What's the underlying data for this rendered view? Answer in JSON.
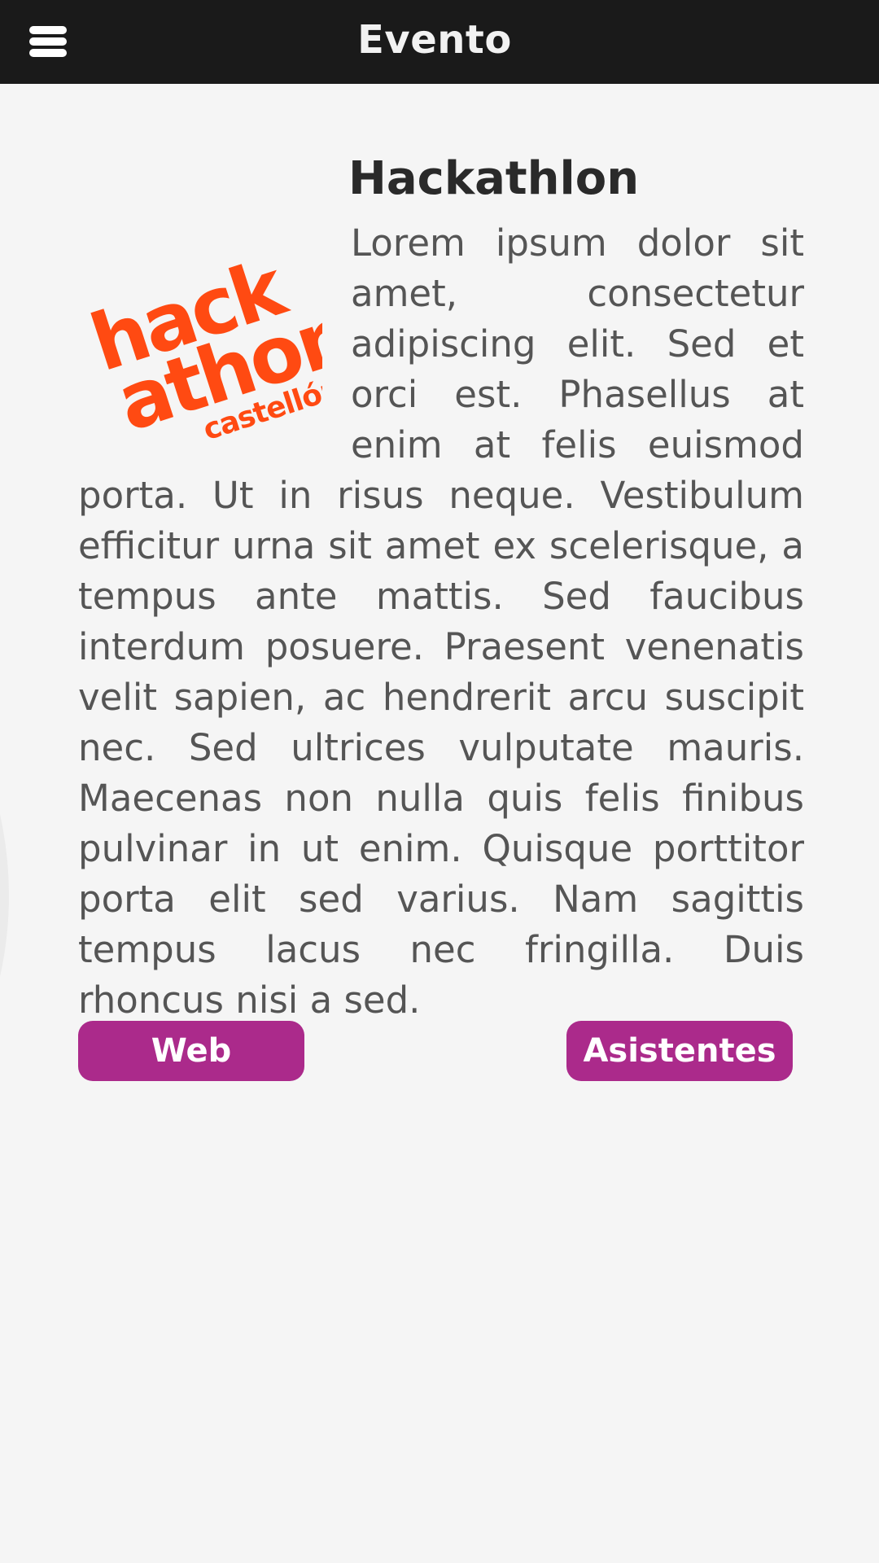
{
  "header": {
    "title": "Evento",
    "menu_icon": "hamburger-menu-icon",
    "background": "#1a1a1a"
  },
  "event": {
    "title": "Hackathlon",
    "logo": {
      "name": "hackathon-castellon-logo",
      "line1": "hack",
      "line2": "athon",
      "line3": "castellón",
      "color": "#ff4a12"
    },
    "description": "Lorem ipsum dolor sit amet, consectetur adipiscing elit. Sed et orci est. Phasellus at enim at felis euismod porta. Ut in risus neque. Vestibulum efficitur urna sit amet ex scelerisque, a tempus ante mattis. Sed faucibus interdum posuere. Praesent venenatis velit sapien, ac hendrerit arcu suscipit nec. Sed ultrices vulputate mauris. Maecenas non nulla quis felis finibus pulvinar in ut enim. Quisque porttitor porta elit sed varius. Nam sagittis tempus lacus nec fringilla. Duis rhoncus nisi a sed."
  },
  "actions": {
    "web_label": "Web",
    "asistentes_label": "Asistentes",
    "accent": "#ab2a8b"
  }
}
